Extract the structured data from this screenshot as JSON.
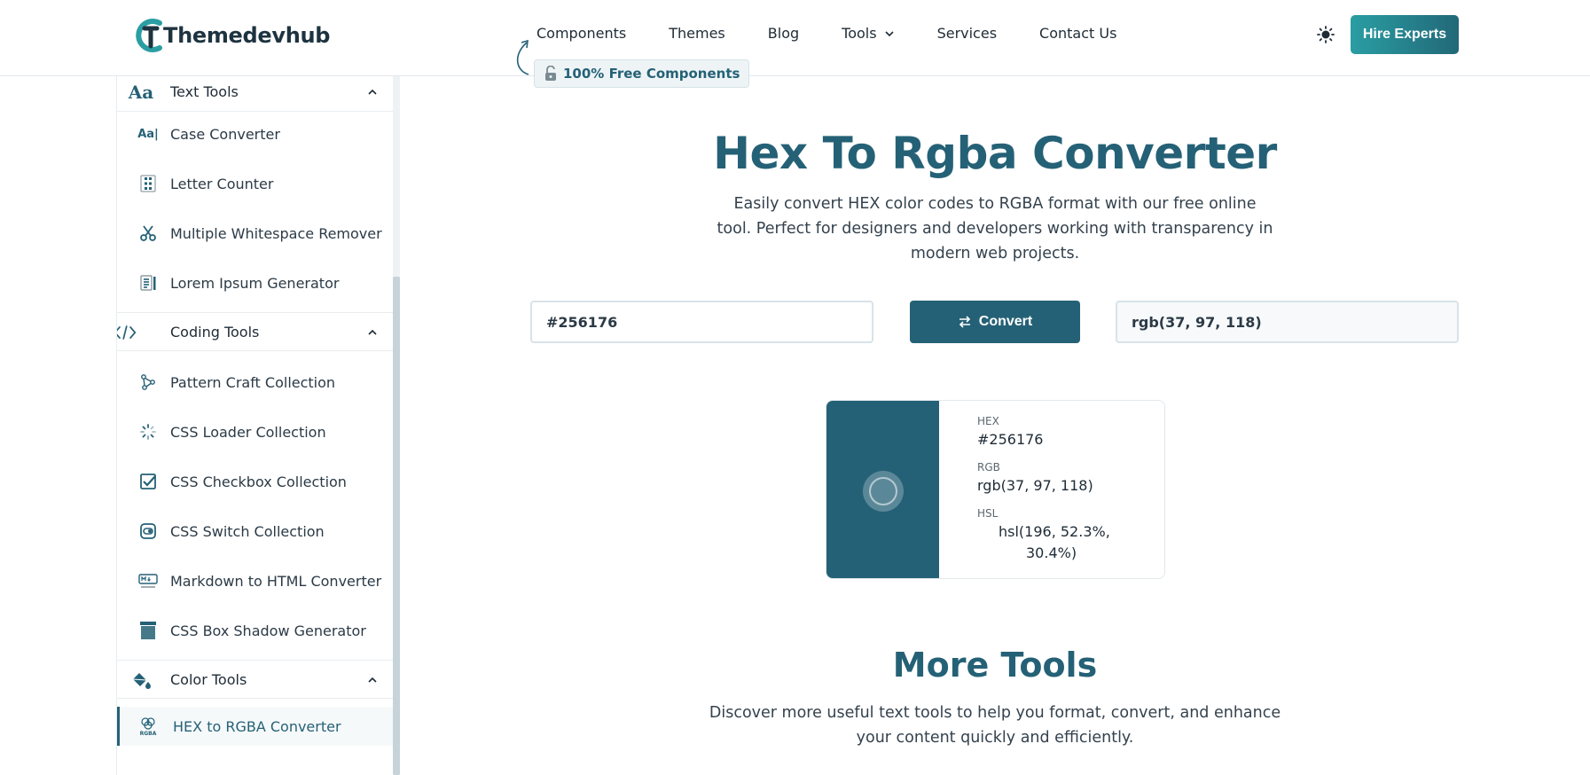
{
  "header": {
    "logo_text": "Themedevhub",
    "nav": [
      {
        "label": "Components"
      },
      {
        "label": "Themes"
      },
      {
        "label": "Blog"
      },
      {
        "label": "Tools"
      },
      {
        "label": "Services"
      },
      {
        "label": "Contact Us"
      }
    ],
    "free_badge": "100% Free Components",
    "hire_button": "Hire Experts"
  },
  "sidebar": {
    "sections": [
      {
        "title": "Text Tools",
        "icon": "text-aa-icon",
        "items": [
          {
            "label": "Case Converter",
            "icon": "case-icon"
          },
          {
            "label": "Letter Counter",
            "icon": "counter-icon"
          },
          {
            "label": "Multiple Whitespace Remover",
            "icon": "scissors-icon"
          },
          {
            "label": "Lorem Ipsum Generator",
            "icon": "document-icon"
          }
        ]
      },
      {
        "title": "Coding Tools",
        "icon": "code-icon",
        "items": [
          {
            "label": "Pattern Craft Collection",
            "icon": "nodes-icon"
          },
          {
            "label": "CSS Loader Collection",
            "icon": "spinner-icon"
          },
          {
            "label": "CSS Checkbox Collection",
            "icon": "checkbox-icon"
          },
          {
            "label": "CSS Switch Collection",
            "icon": "switch-icon"
          },
          {
            "label": "Markdown to HTML Converter",
            "icon": "markdown-icon"
          },
          {
            "label": "CSS Box Shadow Generator",
            "icon": "box-icon"
          }
        ]
      },
      {
        "title": "Color Tools",
        "icon": "paint-bucket-icon",
        "items": [
          {
            "label": "HEX to RGBA Converter",
            "icon": "rgba-palette-icon",
            "active": true
          }
        ]
      }
    ]
  },
  "main": {
    "title": "Hex To Rgba Converter",
    "description": "Easily convert HEX color codes to RGBA format with our free online tool. Perfect for designers and developers working with transparency in modern web projects.",
    "hex_input_value": "#256176",
    "convert_label": "Convert",
    "rgb_output_value": "rgb(37, 97, 118)",
    "result": {
      "swatch_color": "#256176",
      "hex_label": "HEX",
      "hex_value": "#256176",
      "rgb_label": "RGB",
      "rgb_value": "rgb(37, 97, 118)",
      "hsl_label": "HSL",
      "hsl_value_line1": "hsl(196, 52.3%,",
      "hsl_value_line2": "30.4%)"
    },
    "more_tools_title": "More Tools",
    "more_tools_description": "Discover more useful text tools to help you format, convert, and enhance your content quickly and efficiently."
  },
  "colors": {
    "brand": "#256176",
    "accent": "#2a9ea3"
  }
}
